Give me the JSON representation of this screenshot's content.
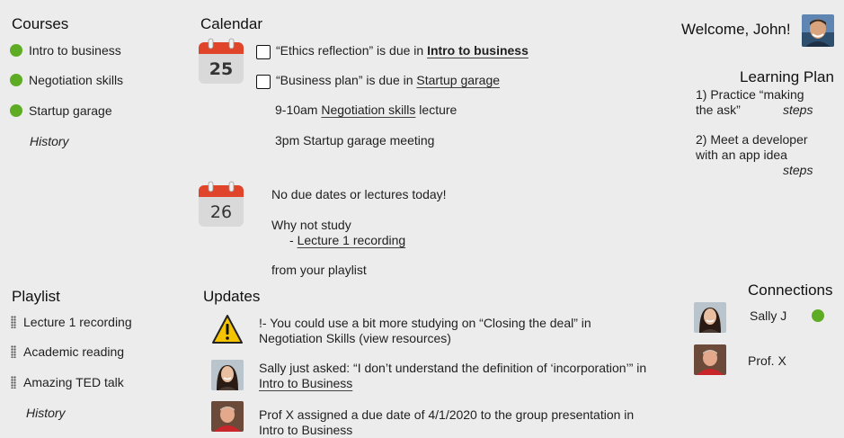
{
  "courses": {
    "title": "Courses",
    "items": [
      {
        "label": "Intro to business"
      },
      {
        "label": "Negotiation skills"
      },
      {
        "label": "Startup garage"
      }
    ],
    "history": "History"
  },
  "calendar": {
    "title": "Calendar",
    "days": [
      {
        "day": "25",
        "tasks": [
          {
            "prefix": "“Ethics reflection” is due in ",
            "link": "Intro to business"
          },
          {
            "prefix": "“Business plan” is due in ",
            "link": "Startup garage"
          }
        ],
        "events": [
          {
            "time": "9-10am ",
            "link": "Negotiation skills",
            "suffix": " lecture"
          },
          {
            "text": "3pm Startup garage meeting"
          }
        ]
      },
      {
        "day": "26",
        "no_due": "No due dates or lectures today!",
        "why": "Why not study",
        "dash": "- ",
        "rec_link": "Lecture 1 recording",
        "from": "from your playlist"
      }
    ]
  },
  "user": {
    "welcome": "Welcome, John!"
  },
  "learning_plan": {
    "title": "Learning Plan",
    "items": [
      {
        "line1": "1) Practice “making",
        "line2": "the ask”",
        "steps": "steps"
      },
      {
        "line1": "2) Meet a developer",
        "line2": "with an app idea",
        "steps": "steps"
      }
    ]
  },
  "playlist": {
    "title": "Playlist",
    "items": [
      {
        "label": "Lecture 1 recording"
      },
      {
        "label": "Academic reading"
      },
      {
        "label": "Amazing TED talk"
      }
    ],
    "history": "History"
  },
  "updates": {
    "title": "Updates",
    "items": [
      {
        "line1": "!- You could use a bit more studying on “Closing the deal” in",
        "line2": "Negotiation Skills (view resources)"
      },
      {
        "line1": "Sally just asked: “I don’t understand the definition of ‘incorporation’” in",
        "link": "Intro to Business"
      },
      {
        "line1": "Prof X assigned a due date of 4/1/2020 to the group presentation in",
        "line2": "Intro to Business"
      }
    ]
  },
  "connections": {
    "title": "Connections",
    "items": [
      {
        "name": "Sally J",
        "online": true
      },
      {
        "name": "Prof. X",
        "online": false
      }
    ]
  },
  "colors": {
    "background": "#ececec",
    "online_green": "#5eac24",
    "calendar_red": "#e0452b",
    "warning_yellow": "#f5c400"
  }
}
